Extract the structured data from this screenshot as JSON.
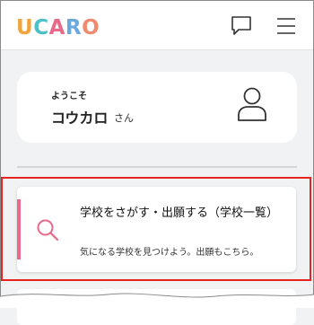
{
  "header": {
    "logo": {
      "letters": [
        "U",
        "C",
        "A",
        "R",
        "O"
      ],
      "colors": [
        "#f2a43a",
        "#4cc0c9",
        "#e8698a",
        "#6ba9dd",
        "#f08a6e"
      ]
    },
    "chat_icon": "chat-bubble-icon",
    "menu_icon": "hamburger-menu-icon"
  },
  "user_card": {
    "greeting": "ようこそ",
    "name": "コウカロ",
    "suffix": "さん",
    "avatar_icon": "user-icon"
  },
  "search_card": {
    "title": "学校をさがす・出願する（学校一覧）",
    "subtitle": "気になる学校を見つけよう。出願もこちら。",
    "icon": "search-icon",
    "accent_color": "#e8698a"
  },
  "highlight_color": "#e52420"
}
